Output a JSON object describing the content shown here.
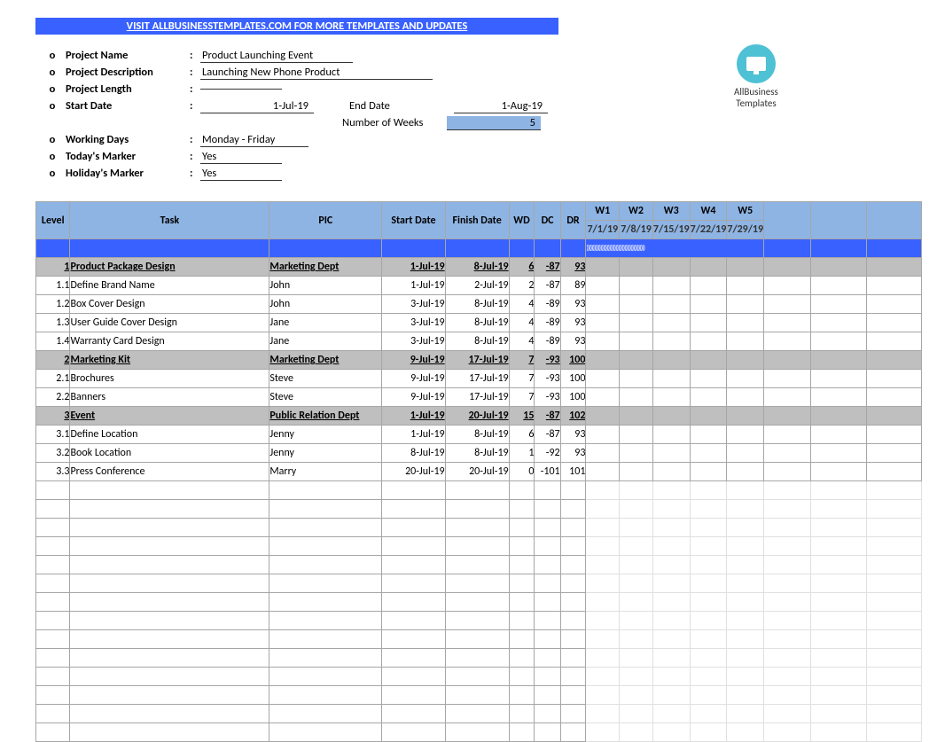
{
  "banner": "VISIT ALLBUSINESSTEMPLATES.COM FOR MORE TEMPLATES AND UPDATES",
  "logo_line1": "AllBusiness",
  "logo_line2": "Templates",
  "meta": {
    "project_name_label": "Project Name",
    "project_name": "Product Launching Event",
    "project_desc_label": "Project Description",
    "project_desc": "Launching New Phone Product",
    "project_length_label": "Project Length",
    "project_length": "",
    "start_date_label": "Start Date",
    "start_date": "1-Jul-19",
    "end_date_label": "End Date",
    "end_date": "1-Aug-19",
    "num_weeks_label": "Number of Weeks",
    "num_weeks": "5",
    "working_days_label": "Working Days",
    "working_days": "Monday - Friday",
    "today_marker_label": "Today's Marker",
    "today_marker": "Yes",
    "holiday_marker_label": "Holiday's Marker",
    "holiday_marker": "Yes"
  },
  "headers": {
    "level": "Level",
    "task": "Task",
    "pic": "PIC",
    "start": "Start Date",
    "finish": "Finish Date",
    "wd": "WD",
    "dc": "DC",
    "dr": "DR"
  },
  "weeks": [
    {
      "w": "W1",
      "d": "7/1/19"
    },
    {
      "w": "W2",
      "d": "7/8/19"
    },
    {
      "w": "W3",
      "d": "7/15/19"
    },
    {
      "w": "W4",
      "d": "7/22/19"
    },
    {
      "w": "W5",
      "d": "7/29/19"
    }
  ],
  "rows": [
    {
      "type": "parent",
      "level": "1",
      "task": "Product Package Design",
      "pic": "Marketing Dept",
      "start": "1-Jul-19",
      "finish": "8-Jul-19",
      "wd": "6",
      "dc": "-87",
      "dr": "93"
    },
    {
      "type": "child",
      "level": "1.1",
      "task": "Define Brand Name",
      "pic": "John",
      "start": "1-Jul-19",
      "finish": "2-Jul-19",
      "wd": "2",
      "dc": "-87",
      "dr": "89"
    },
    {
      "type": "child",
      "level": "1.2",
      "task": "Box Cover Design",
      "pic": "John",
      "start": "3-Jul-19",
      "finish": "8-Jul-19",
      "wd": "4",
      "dc": "-89",
      "dr": "93"
    },
    {
      "type": "child",
      "level": "1.3",
      "task": "User Guide Cover Design",
      "pic": "Jane",
      "start": "3-Jul-19",
      "finish": "8-Jul-19",
      "wd": "4",
      "dc": "-89",
      "dr": "93"
    },
    {
      "type": "child",
      "level": "1.4",
      "task": "Warranty Card Design",
      "pic": "Jane",
      "start": "3-Jul-19",
      "finish": "8-Jul-19",
      "wd": "4",
      "dc": "-89",
      "dr": "93"
    },
    {
      "type": "parent",
      "level": "2",
      "task": "Marketing Kit",
      "pic": "Marketing Dept",
      "start": "9-Jul-19",
      "finish": "17-Jul-19",
      "wd": "7",
      "dc": "-93",
      "dr": "100"
    },
    {
      "type": "child",
      "level": "2.1",
      "task": "Brochures",
      "pic": "Steve",
      "start": "9-Jul-19",
      "finish": "17-Jul-19",
      "wd": "7",
      "dc": "-93",
      "dr": "100"
    },
    {
      "type": "child",
      "level": "2.2",
      "task": "Banners",
      "pic": "Steve",
      "start": "9-Jul-19",
      "finish": "17-Jul-19",
      "wd": "7",
      "dc": "-93",
      "dr": "100"
    },
    {
      "type": "parent",
      "level": "3",
      "task": "Event",
      "pic": "Public Relation Dept",
      "start": "1-Jul-19",
      "finish": "20-Jul-19",
      "wd": "15",
      "dc": "-87",
      "dr": "102"
    },
    {
      "type": "child",
      "level": "3.1",
      "task": "Define Location",
      "pic": "Jenny",
      "start": "1-Jul-19",
      "finish": "8-Jul-19",
      "wd": "6",
      "dc": "-87",
      "dr": "93"
    },
    {
      "type": "child",
      "level": "3.2",
      "task": "Book Location",
      "pic": "Jenny",
      "start": "8-Jul-19",
      "finish": "8-Jul-19",
      "wd": "1",
      "dc": "-92",
      "dr": "93"
    },
    {
      "type": "child",
      "level": "3.3",
      "task": "Press Conference",
      "pic": "Marry",
      "start": "20-Jul-19",
      "finish": "20-Jul-19",
      "wd": "0",
      "dc": "-101",
      "dr": "101"
    }
  ],
  "empty_rows": 14,
  "sep_ticks": "))))))))))))))))))))))))))))))))))))))))))))))"
}
